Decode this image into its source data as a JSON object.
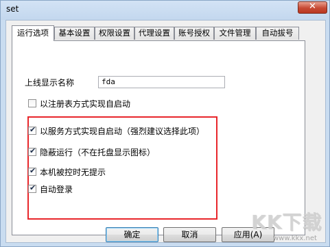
{
  "window": {
    "title": "set",
    "close_glyph": "✕"
  },
  "tabs": [
    {
      "label": "运行选项",
      "active": true
    },
    {
      "label": "基本设置",
      "active": false
    },
    {
      "label": "权限设置",
      "active": false
    },
    {
      "label": "代理设置",
      "active": false
    },
    {
      "label": "账号授权",
      "active": false
    },
    {
      "label": "文件管理",
      "active": false
    },
    {
      "label": "自动拔号",
      "active": false
    }
  ],
  "form": {
    "display_name_label": "上线显示名称",
    "display_name_value": "fda",
    "options": [
      {
        "label": "以注册表方式实现自启动",
        "checked": false
      },
      {
        "label": "以服务方式实现自启动（强烈建议选择此项）",
        "checked": true
      },
      {
        "label": "隐蔽运行（不在托盘显示图标）",
        "checked": true
      },
      {
        "label": "本机被控时无提示",
        "checked": true
      },
      {
        "label": "自动登录",
        "checked": true
      }
    ],
    "check_glyph": "✔"
  },
  "buttons": {
    "ok": "确定",
    "cancel": "取消",
    "apply": "应用(A)"
  },
  "watermark": {
    "brand": "KK下载",
    "url": "www.kkx.net"
  },
  "colors": {
    "highlight": "#e8252a",
    "frame": "#c9dcf0"
  }
}
